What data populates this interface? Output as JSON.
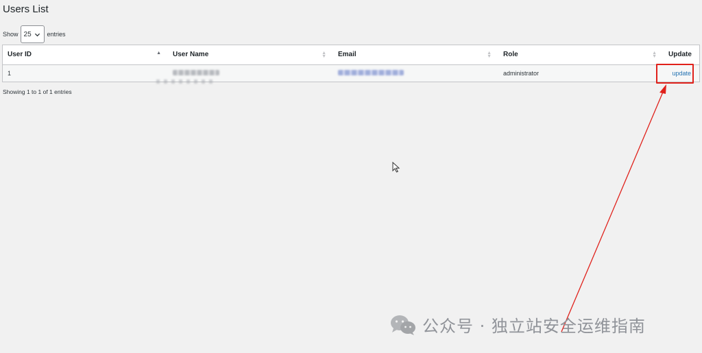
{
  "page": {
    "title": "Users List"
  },
  "length": {
    "show_label": "Show",
    "value": "25",
    "entries_label": "entries"
  },
  "table": {
    "columns": [
      "User ID",
      "User Name",
      "Email",
      "Role",
      "Update"
    ],
    "rows": [
      {
        "id": "1",
        "username": "(redacted)",
        "email": "(redacted)",
        "role": "administrator",
        "action": "update"
      }
    ]
  },
  "info": "Showing 1 to 1 of 1 entries",
  "watermark": {
    "text": "公众号 · 独立站安全运维指南",
    "icon": "wechat-icon"
  },
  "colors": {
    "link": "#2271b1",
    "annotation": "#e0201a",
    "background": "#f1f1f1"
  }
}
